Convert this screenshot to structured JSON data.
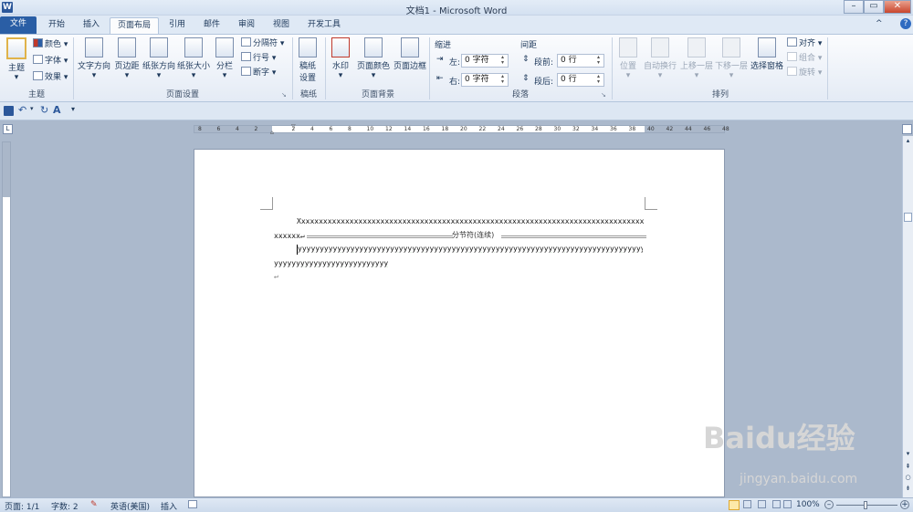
{
  "window": {
    "title": "文档1 - Microsoft Word",
    "app_icon": "W"
  },
  "tabs": [
    {
      "label": "文件"
    },
    {
      "label": "开始"
    },
    {
      "label": "插入"
    },
    {
      "label": "页面布局"
    },
    {
      "label": "引用"
    },
    {
      "label": "邮件"
    },
    {
      "label": "审阅"
    },
    {
      "label": "视图"
    },
    {
      "label": "开发工具"
    }
  ],
  "ribbon": {
    "theme": {
      "label": "主题",
      "themes": "主题",
      "colors": "颜色",
      "fonts": "字体",
      "effects": "效果"
    },
    "page_setup": {
      "label": "页面设置",
      "text_direction": "文字方向",
      "margins": "页边距",
      "orientation": "纸张方向",
      "size": "纸张大小",
      "columns": "分栏",
      "breaks": "分隔符",
      "line_numbers": "行号",
      "hyphenation": "断字"
    },
    "draft": {
      "label": "稿纸",
      "button_line1": "稿纸",
      "button_line2": "设置"
    },
    "page_background": {
      "label": "页面背景",
      "watermark": "水印",
      "page_color": "页面颜色",
      "page_borders": "页面边框"
    },
    "paragraph": {
      "label": "段落",
      "indent": "缩进",
      "spacing": "间距",
      "left_label": "左:",
      "left_value": "0 字符",
      "right_label": "右:",
      "right_value": "0 字符",
      "before_label": "段前:",
      "before_value": "0 行",
      "after_label": "段后:",
      "after_value": "0 行"
    },
    "arrange": {
      "label": "排列",
      "position": "位置",
      "wrap_text": "自动换行",
      "bring_forward": "上移一层",
      "send_backward": "下移一层",
      "selection_pane": "选择窗格",
      "align": "对齐",
      "group": "组合",
      "rotate": "旋转"
    }
  },
  "document": {
    "line1": "Xxxxxxxxxxxxxxxxxxxxxxxxxxxxxxxxxxxxxxxxxxxxxxxxxxxxxxxxxxxxxxxxxxxxxxxxxxxxxxxxxxxxxxxxxxxxxxxxxxxxxxx",
    "line2": "xxxxxx↵",
    "section_break": "分节符(连续)",
    "line3": "yyyyyyyyyyyyyyyyyyyyyyyyyyyyyyyyyyyyyyyyyyyyyyyyyyyyyyyyyyyyyyyyyyyyyyyyyyyyyyyyyyyyyyyyyy",
    "line4": "yyyyyyyyyyyyyyyyyyyyyyyyyyy↵",
    "line5": "↵"
  },
  "ruler_labels": [
    "8",
    "6",
    "4",
    "2",
    "",
    "2",
    "4",
    "6",
    "8",
    "10",
    "12",
    "14",
    "16",
    "18",
    "20",
    "22",
    "24",
    "26",
    "28",
    "30",
    "32",
    "34",
    "36",
    "38",
    "40",
    "42",
    "44",
    "46",
    "48"
  ],
  "status": {
    "page": "页面: 1/1",
    "words": "字数: 2",
    "language": "英语(美国)",
    "mode": "插入",
    "zoom": "100%"
  },
  "watermark": {
    "brand": "Baidu经验",
    "url": "jingyan.baidu.com"
  },
  "colors": {
    "file_tab": "#2a5ea5",
    "ribbon": "#e4ebf5",
    "workspace": "#abb9cc"
  }
}
